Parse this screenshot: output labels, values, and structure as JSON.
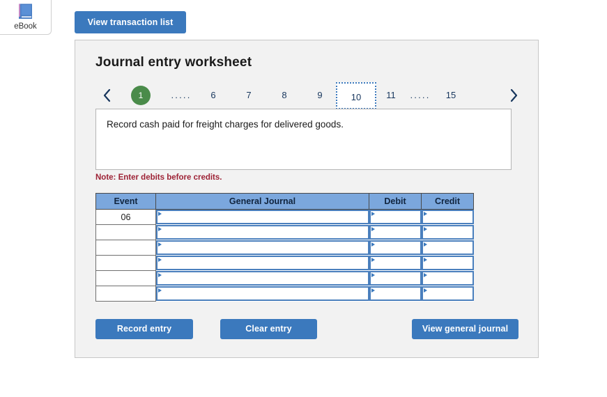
{
  "ebook": {
    "label": "eBook",
    "icon": "book-icon"
  },
  "toolbar": {
    "view_transaction_list": "View transaction list"
  },
  "panel": {
    "title": "Journal entry worksheet"
  },
  "pager": {
    "prev_icon": "chevron-left-icon",
    "next_icon": "chevron-right-icon",
    "first": "1",
    "ellipsis_left": ".....",
    "n6": "6",
    "n7": "7",
    "n8": "8",
    "n9": "9",
    "current": "10",
    "n11": "11",
    "ellipsis_right": ".....",
    "last": "15"
  },
  "description": {
    "text": "Record cash paid for freight charges for delivered goods."
  },
  "note": {
    "text": "Note: Enter debits before credits."
  },
  "table": {
    "headers": {
      "event": "Event",
      "general_journal": "General Journal",
      "debit": "Debit",
      "credit": "Credit"
    },
    "rows": [
      {
        "event": "06",
        "general_journal": "",
        "debit": "",
        "credit": ""
      },
      {
        "event": "",
        "general_journal": "",
        "debit": "",
        "credit": ""
      },
      {
        "event": "",
        "general_journal": "",
        "debit": "",
        "credit": ""
      },
      {
        "event": "",
        "general_journal": "",
        "debit": "",
        "credit": ""
      },
      {
        "event": "",
        "general_journal": "",
        "debit": "",
        "credit": ""
      },
      {
        "event": "",
        "general_journal": "",
        "debit": "",
        "credit": ""
      }
    ]
  },
  "actions": {
    "record_entry": "Record entry",
    "clear_entry": "Clear entry",
    "view_general_journal": "View general journal"
  },
  "colors": {
    "button_blue": "#3b79bd",
    "header_blue": "#7ba7dd",
    "panel_bg": "#f2f2f2",
    "note_red": "#9d2235",
    "pager_active_green": "#4a8b4a",
    "pager_text": "#17365d",
    "input_border": "#4a7fbd"
  }
}
